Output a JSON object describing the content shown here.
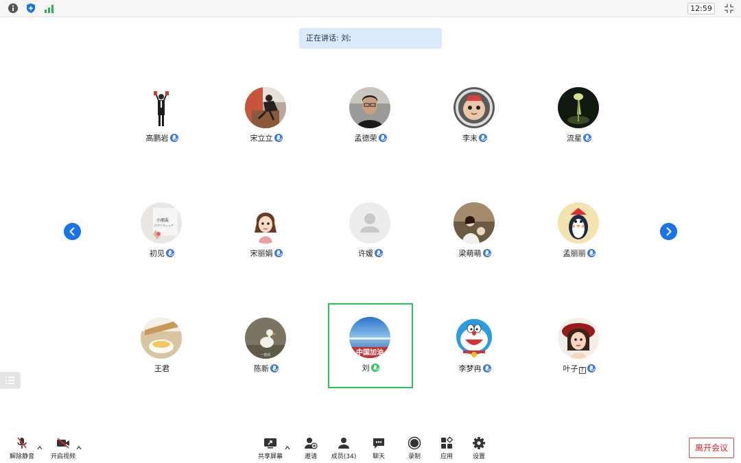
{
  "topbar": {
    "info_icon": "info-icon",
    "shield_icon": "shield-icon",
    "signal_icon": "signal-icon",
    "time": "12:59",
    "shrink_icon": "exit-fullscreen-icon"
  },
  "speaking": {
    "text": "正在讲话: 刘;"
  },
  "participants": [
    {
      "name": "高鹏岩",
      "mic": "mic-icon"
    },
    {
      "name": "宋立立",
      "mic": "mic-icon"
    },
    {
      "name": "孟德荣",
      "mic": "mic-icon"
    },
    {
      "name": "李末",
      "mic": "mic-icon"
    },
    {
      "name": "流星",
      "mic": "mic-icon"
    },
    {
      "name": "初见",
      "mic": "mic-icon"
    },
    {
      "name": "宋丽娟",
      "mic": "mic-icon"
    },
    {
      "name": "许媛",
      "mic": "mic-icon"
    },
    {
      "name": "梁萌萌",
      "mic": "mic-icon"
    },
    {
      "name": "孟丽丽",
      "mic": "mic-icon"
    },
    {
      "name": "王君",
      "mic": ""
    },
    {
      "name": "陈新",
      "mic": "mic-icon"
    },
    {
      "name": "刘",
      "mic": "mic-icon",
      "speaking": true
    },
    {
      "name": "李梦冉",
      "mic": "mic-icon"
    },
    {
      "name": "叶子",
      "badge": "?",
      "mic": "mic-icon"
    }
  ],
  "avatar_texts": {
    "chujian_1": "小朋友",
    "chujian_2": "ロマンティック",
    "chenxin": "一鹤鸣",
    "liu": "中国加油"
  },
  "toolbar": {
    "unmute": "解除静音",
    "start_video": "开启视频",
    "share_screen": "共享屏幕",
    "invite": "邀请",
    "members": "成员(34)",
    "chat": "聊天",
    "record": "录制",
    "apps": "应用",
    "settings": "设置",
    "leave": "离开会议"
  },
  "colors": {
    "accent_blue": "#1a73e8",
    "speaking_border": "#2bc25a",
    "leave_red": "#e02020",
    "banner_bg": "#dceafd"
  }
}
